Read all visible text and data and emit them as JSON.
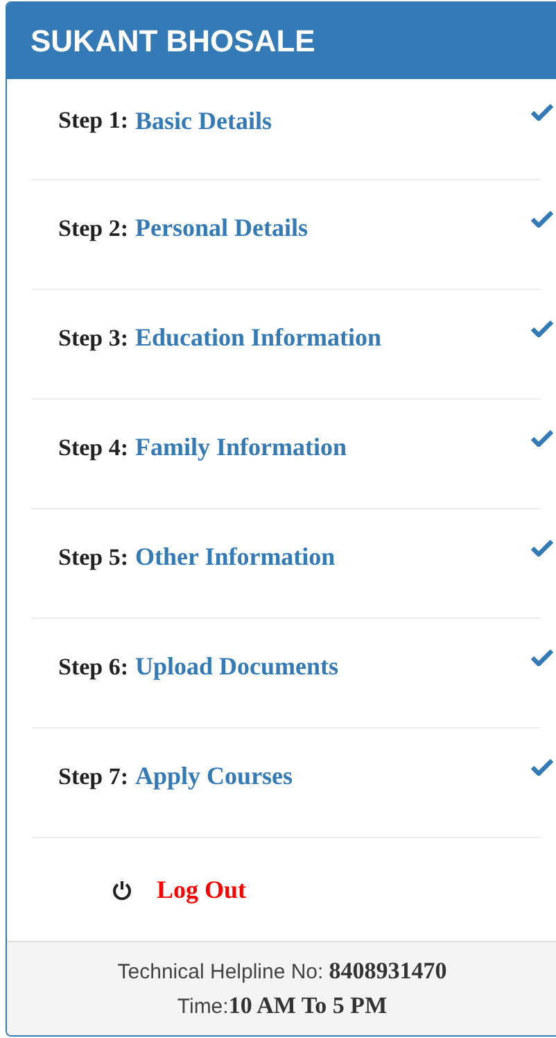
{
  "header": {
    "title": "SUKANT BHOSALE"
  },
  "steps": [
    {
      "prefix": "Step 1:",
      "label": "Basic Details",
      "done": true
    },
    {
      "prefix": "Step 2:",
      "label": "Personal Details",
      "done": true
    },
    {
      "prefix": "Step 3:",
      "label": "Education Information",
      "done": true
    },
    {
      "prefix": "Step 4:",
      "label": "Family Information",
      "done": true
    },
    {
      "prefix": "Step 5:",
      "label": "Other Information",
      "done": true
    },
    {
      "prefix": "Step 6:",
      "label": "Upload Documents",
      "done": true
    },
    {
      "prefix": "Step 7:",
      "label": "Apply Courses",
      "done": true
    }
  ],
  "logout": {
    "label": "Log Out"
  },
  "footer": {
    "helpline_label": "Technical Helpline No:",
    "helpline_number": "8408931470",
    "time_label": "Time:",
    "time_value": "10 AM To 5 PM"
  }
}
